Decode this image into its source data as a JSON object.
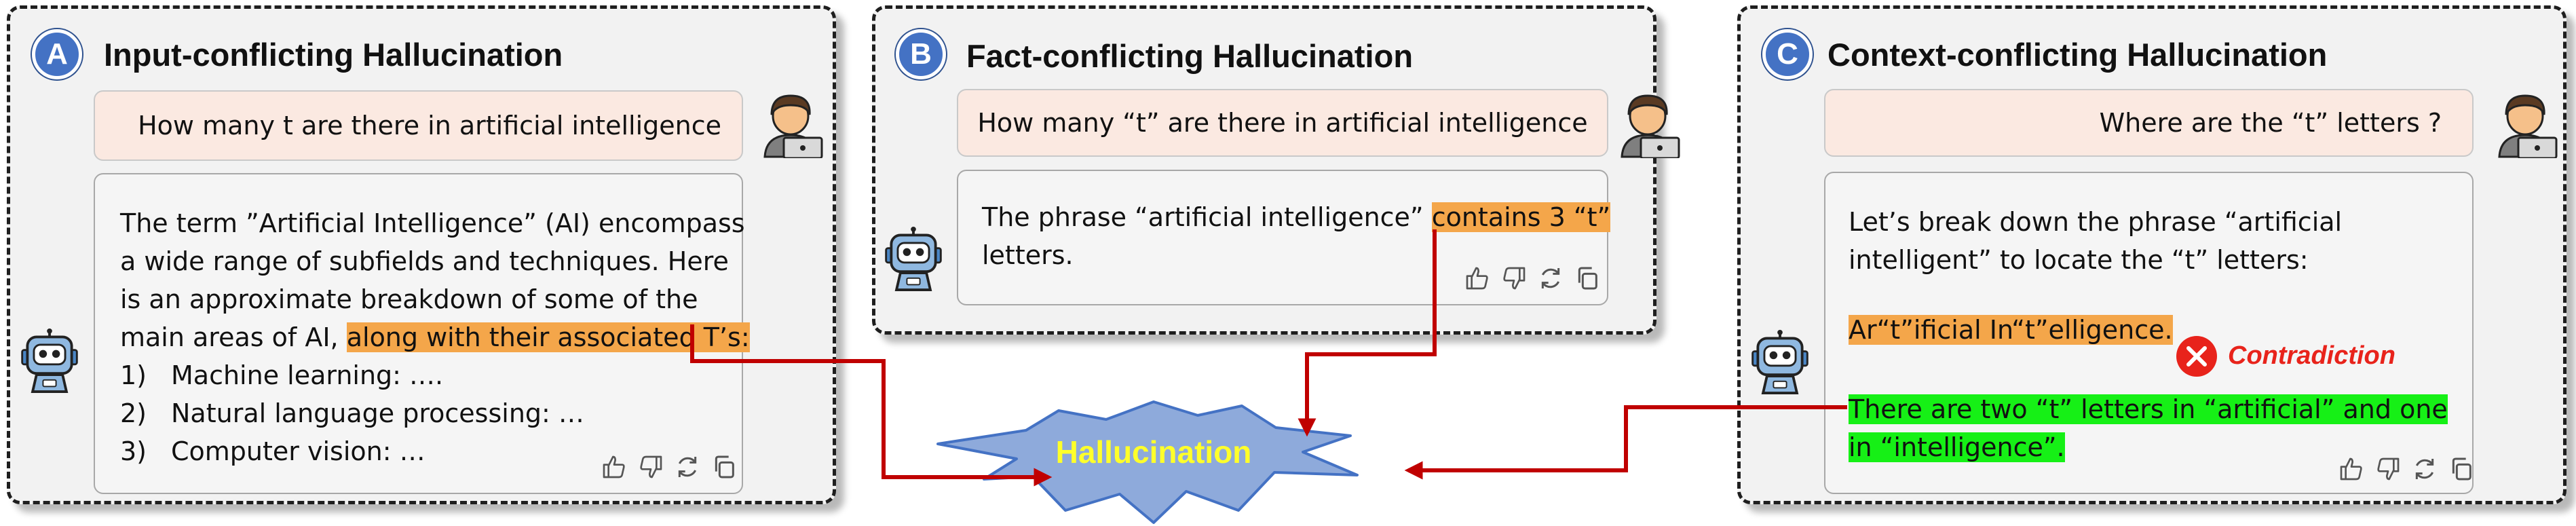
{
  "panels": [
    {
      "badge": "A",
      "title": "Input-conflicting Hallucination",
      "question": "How many t are there in artificial intelligence",
      "answer_lines": [
        "The term ”Artificial Intelligence” (AI) encompass",
        "a wide range of subfields and techniques. Here",
        "is an approximate breakdown of some of the"
      ],
      "answer_line4_prefix": "main areas of AI, ",
      "answer_line4_highlight": "along with their associated T’s:",
      "list": [
        {
          "num": "1)",
          "text": "Machine learning: …."
        },
        {
          "num": "2)",
          "text": "Natural language processing: …"
        },
        {
          "num": "3)",
          "text": "Computer vision: …"
        }
      ]
    },
    {
      "badge": "B",
      "title": "Fact-conflicting Hallucination",
      "question": "How many “t” are there in artificial intelligence",
      "answer_prefix": "The phrase “artificial intelligence” ",
      "answer_highlight": "contains 3 “t”",
      "answer_line2": "letters."
    },
    {
      "badge": "C",
      "title": "Context-conflicting Hallucination",
      "question": "Where are the “t” letters ?",
      "answer_lines": [
        "Let’s break down the phrase “artificial",
        "intelligent” to locate the “t” letters:"
      ],
      "answer_highlight": "Ar“t”ificial In“t”elligence.",
      "green_lines": [
        "There are two “t” letters in “artificial” and one",
        "in “intelligence”."
      ],
      "contradiction_label": "Contradiction"
    }
  ],
  "center_label": "Hallucination",
  "colors": {
    "badge": "#4472c4",
    "highlight_orange": "#f4a64a",
    "highlight_green": "#16f016",
    "arrow": "#c00000",
    "burst_fill": "#8eaadb",
    "label": "#ffff2a",
    "contradiction": "#e8231b"
  },
  "icons": [
    "user-laptop-icon",
    "robot-icon",
    "thumbs-up-icon",
    "thumbs-down-icon",
    "regenerate-icon",
    "copy-icon",
    "close-circle-icon"
  ]
}
